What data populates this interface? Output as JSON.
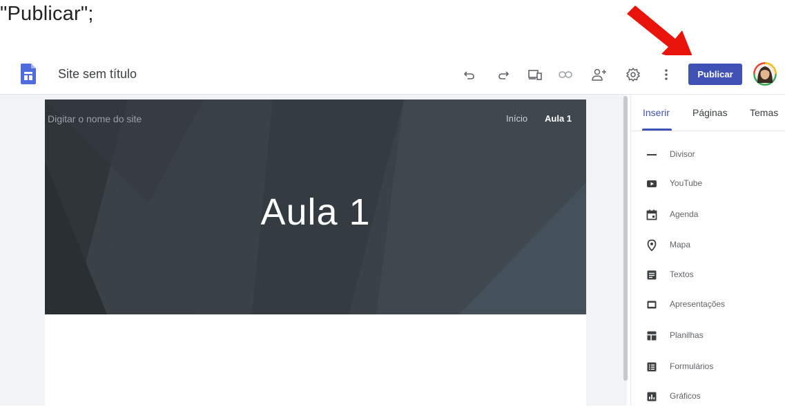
{
  "caption": "\"Publicar\";",
  "topbar": {
    "site_title": "Site sem título",
    "publish_label": "Publicar"
  },
  "hero": {
    "site_name_placeholder": "Digitar o nome do site",
    "nav_home": "Início",
    "nav_current": "Aula 1",
    "title": "Aula 1"
  },
  "panel": {
    "tabs": [
      "Inserir",
      "Páginas",
      "Temas"
    ],
    "items": [
      {
        "label": "Divisor",
        "icon": "divider-icon"
      },
      {
        "label": "YouTube",
        "icon": "youtube-icon"
      },
      {
        "label": "Agenda",
        "icon": "calendar-icon"
      },
      {
        "label": "Mapa",
        "icon": "map-pin-icon"
      },
      {
        "label": "Textos",
        "icon": "docs-icon"
      },
      {
        "label": "Apresentações",
        "icon": "slides-icon"
      },
      {
        "label": "Planilhas",
        "icon": "sheets-icon"
      },
      {
        "label": "Formulários",
        "icon": "forms-icon"
      },
      {
        "label": "Gráficos",
        "icon": "charts-icon"
      }
    ]
  },
  "colors": {
    "accent": "#3f51b5",
    "hero_bg": "#3a4147",
    "arrow": "#e8140c"
  }
}
